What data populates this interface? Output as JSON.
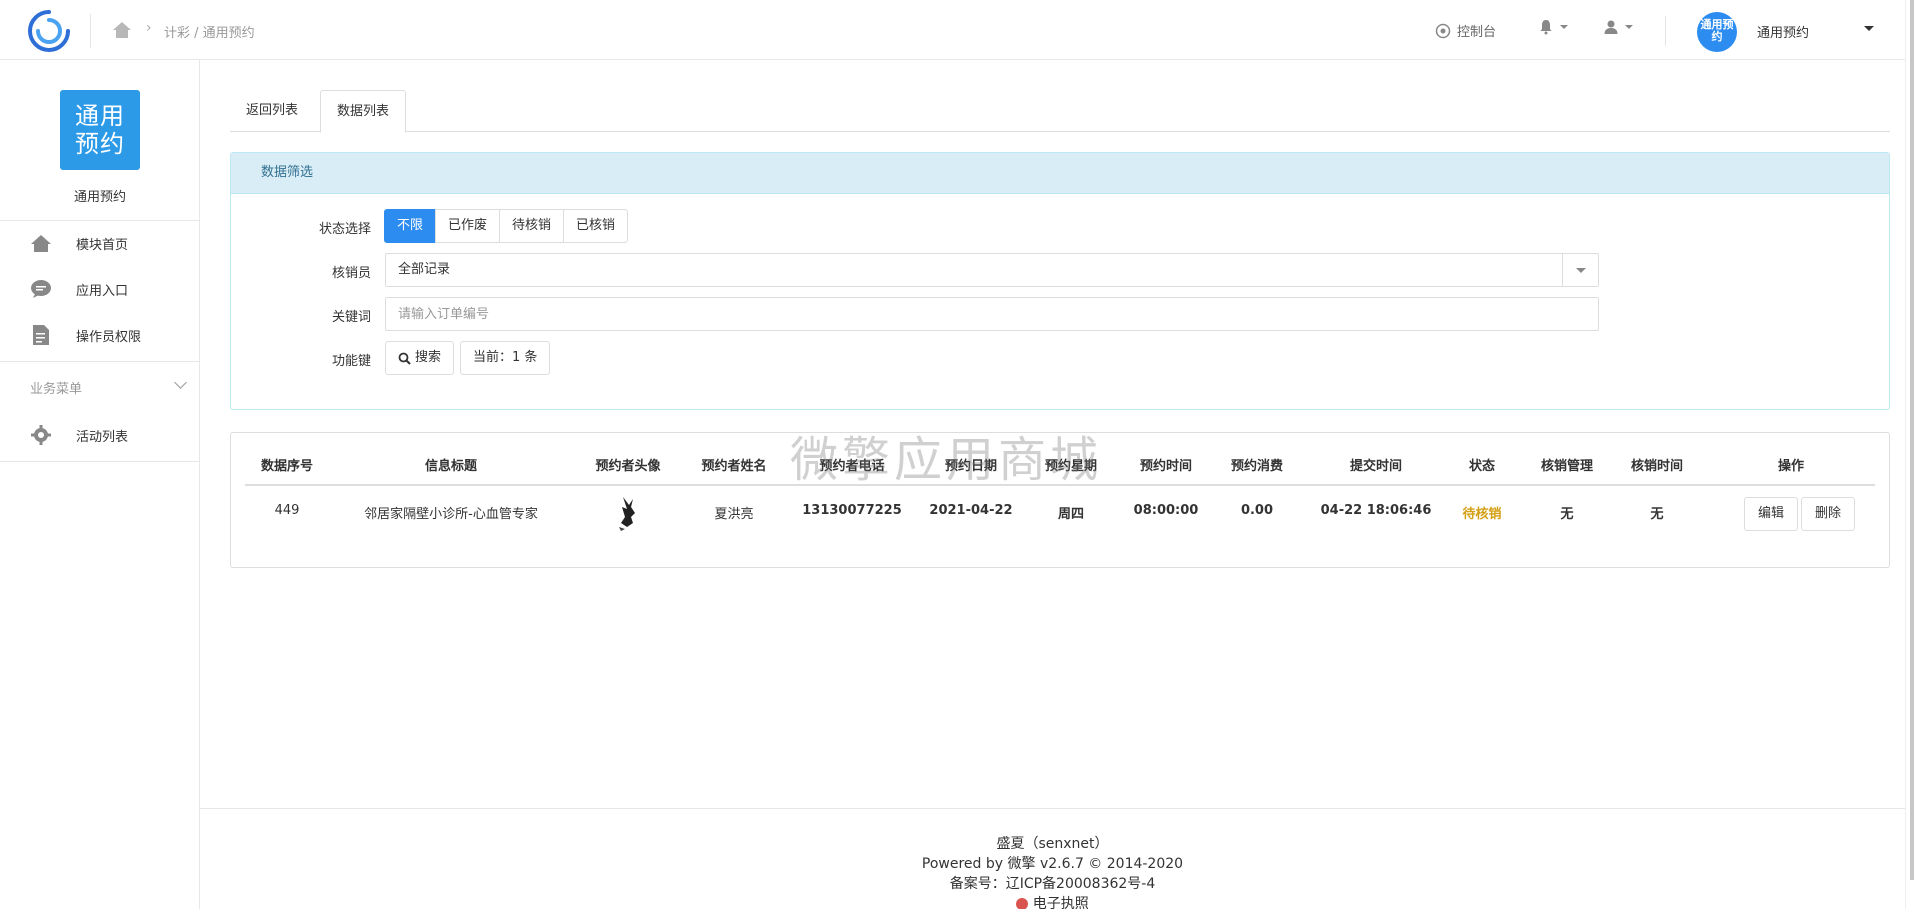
{
  "header": {
    "breadcrumb": "计彩 / 通用预约",
    "console_label": "控制台",
    "avatar_text": "通用预约",
    "user_name": "通用预约"
  },
  "sidebar": {
    "app_logo_text": "通用预约",
    "app_name": "通用预约",
    "items": [
      {
        "label": "模块首页",
        "icon": "home-icon"
      },
      {
        "label": "应用入口",
        "icon": "chat-icon"
      },
      {
        "label": "操作员权限",
        "icon": "document-icon"
      }
    ],
    "group_label": "业务菜单",
    "group_items": [
      {
        "label": "活动列表",
        "icon": "gear-icon"
      }
    ]
  },
  "tabs": [
    {
      "label": "返回列表",
      "active": false
    },
    {
      "label": "数据列表",
      "active": true
    }
  ],
  "filter": {
    "title": "数据筛选",
    "status_label": "状态选择",
    "status_options": [
      "不限",
      "已作废",
      "待核销",
      "已核销"
    ],
    "status_selected": "不限",
    "verifier_label": "核销员",
    "verifier_value": "全部记录",
    "keyword_label": "关键词",
    "keyword_placeholder": "请输入订单编号",
    "func_label": "功能键",
    "search_label": "搜索",
    "current_label": "当前：1 条"
  },
  "table": {
    "headers": [
      "数据序号",
      "信息标题",
      "预约者头像",
      "预约者姓名",
      "预约者电话",
      "预约日期",
      "预约星期",
      "预约时间",
      "预约消费",
      "提交时间",
      "状态",
      "核销管理",
      "核销时间",
      "操作"
    ],
    "rows": [
      {
        "id": "449",
        "title": "邻居家隔壁小诊所-心血管专家",
        "name": "夏洪亮",
        "phone": "13130077225",
        "date": "2021-04-22",
        "weekday": "周四",
        "time": "08:00:00",
        "cost": "0.00",
        "submitted": "04-22 18:06:46",
        "status": "待核销",
        "verify_manage": "无",
        "verify_time": "无",
        "edit_label": "编辑",
        "delete_label": "删除"
      }
    ]
  },
  "watermark": "微擎应用商城",
  "footer": {
    "line1": "盛夏（senxnet）",
    "line2": "Powered by 微擎 v2.6.7 © 2014-2020",
    "line3": "备案号：辽ICP备20008362号-4",
    "line4": "电子执照"
  },
  "colors": {
    "primary": "#2d8cf0",
    "panel_head_bg": "#d9edf7",
    "panel_head_text": "#31708f",
    "status_pending": "#d4a017"
  }
}
